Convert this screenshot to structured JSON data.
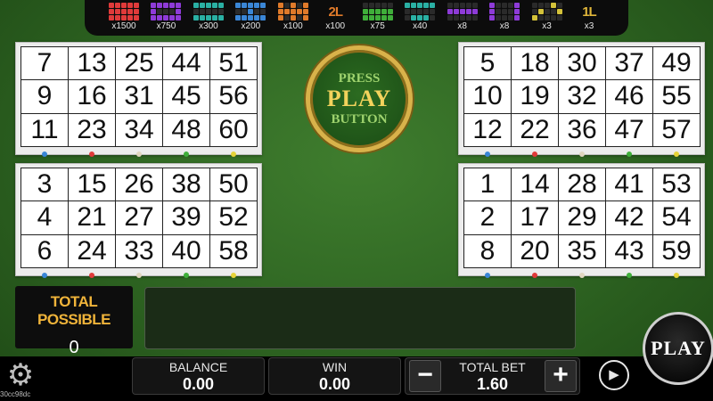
{
  "patterns": [
    {
      "label": "x1500",
      "color": "#e03a3a",
      "cells": [
        1,
        1,
        1,
        1,
        1,
        1,
        1,
        1,
        1,
        1,
        1,
        1,
        1,
        1,
        1
      ]
    },
    {
      "label": "x750",
      "color": "#8e3bd8",
      "cells": [
        1,
        1,
        1,
        1,
        1,
        1,
        0,
        0,
        0,
        1,
        1,
        1,
        1,
        1,
        1
      ]
    },
    {
      "label": "x300",
      "color": "#2ab0a4",
      "cells": [
        1,
        1,
        1,
        1,
        1,
        0,
        0,
        0,
        0,
        0,
        1,
        1,
        1,
        1,
        1
      ]
    },
    {
      "label": "x200",
      "color": "#3a86d6",
      "cells": [
        1,
        1,
        1,
        1,
        1,
        0,
        0,
        1,
        0,
        0,
        1,
        1,
        1,
        1,
        1
      ]
    },
    {
      "label": "x100",
      "color": "#e07a2a",
      "cells": [
        1,
        0,
        1,
        0,
        1,
        1,
        1,
        1,
        1,
        1,
        1,
        0,
        1,
        0,
        1
      ]
    },
    {
      "label": "x100",
      "color": "#e07a2a",
      "text": "2L"
    },
    {
      "label": "x75",
      "color": "#3fae3a",
      "cells": [
        0,
        0,
        0,
        0,
        0,
        1,
        1,
        1,
        1,
        1,
        1,
        1,
        1,
        1,
        1
      ]
    },
    {
      "label": "x40",
      "color": "#2ab0a4",
      "cells": [
        1,
        1,
        1,
        1,
        1,
        0,
        0,
        0,
        0,
        0,
        0,
        1,
        1,
        1,
        0
      ]
    },
    {
      "label": "x8",
      "color": "#8e3bd8",
      "cells": [
        0,
        0,
        0,
        0,
        0,
        1,
        1,
        1,
        1,
        1,
        0,
        0,
        0,
        0,
        0
      ]
    },
    {
      "label": "x8",
      "color": "#8e3bd8",
      "cells": [
        1,
        0,
        0,
        0,
        1,
        1,
        0,
        0,
        0,
        1,
        1,
        0,
        0,
        0,
        1
      ]
    },
    {
      "label": "x3",
      "color": "#d4c23a",
      "cells": [
        0,
        0,
        0,
        1,
        0,
        0,
        1,
        0,
        0,
        1,
        1,
        0,
        0,
        0,
        0
      ]
    },
    {
      "label": "x3",
      "color": "#e0b63a",
      "text": "1L"
    }
  ],
  "cards": [
    {
      "numbers": [
        7,
        13,
        25,
        44,
        51,
        9,
        16,
        31,
        45,
        56,
        11,
        23,
        34,
        48,
        60
      ]
    },
    {
      "numbers": [
        5,
        18,
        30,
        37,
        49,
        10,
        19,
        32,
        46,
        55,
        12,
        22,
        36,
        47,
        57
      ]
    },
    {
      "numbers": [
        3,
        15,
        26,
        38,
        50,
        4,
        21,
        27,
        39,
        52,
        6,
        24,
        33,
        40,
        58
      ]
    },
    {
      "numbers": [
        1,
        14,
        28,
        41,
        53,
        2,
        17,
        29,
        42,
        54,
        8,
        20,
        35,
        43,
        59
      ]
    }
  ],
  "card_dot_colors": [
    "#3a86d6",
    "#e03a3a",
    "#e0d6c0",
    "#3fae3a",
    "#e6d43a"
  ],
  "press_play": {
    "line1": "PRESS",
    "line2": "PLAY",
    "line3": "BUTTON"
  },
  "total_possible": {
    "label": "TOTAL POSSIBLE",
    "value": "0"
  },
  "balance": {
    "label": "BALANCE",
    "value": "0.00"
  },
  "win": {
    "label": "WIN",
    "value": "0.00"
  },
  "total_bet": {
    "label": "TOTAL BET",
    "value": "1.60",
    "minus": "−",
    "plus": "+"
  },
  "play_button": "PLAY",
  "autoplay_glyph": "▶",
  "settings_glyph": "⚙",
  "session_id": "30cc98dc"
}
